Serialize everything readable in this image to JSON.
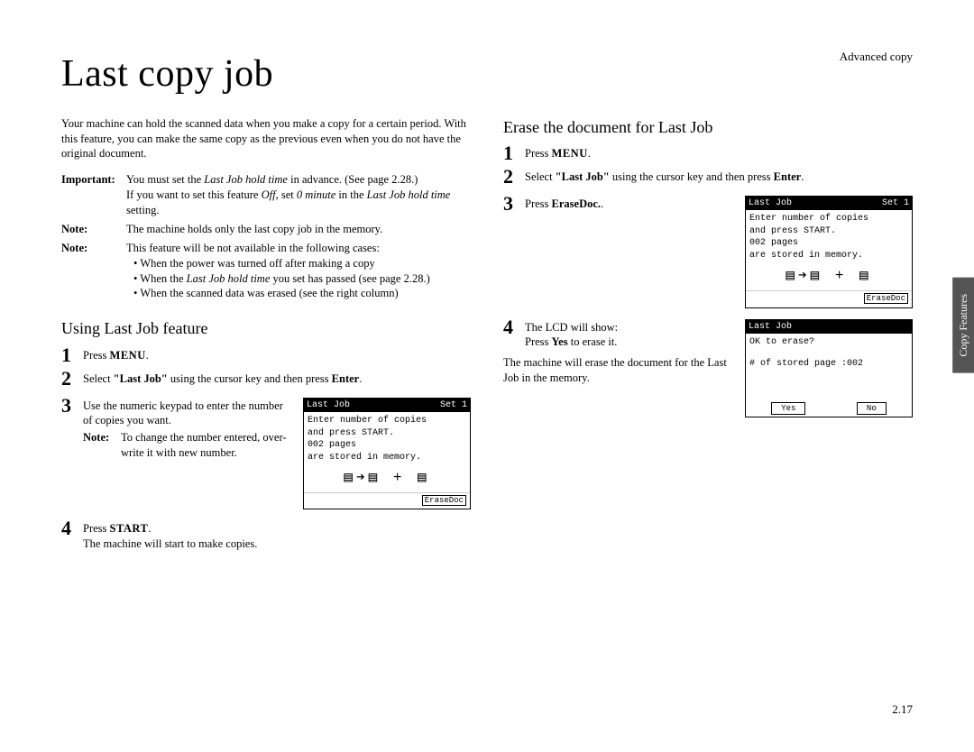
{
  "header": "Advanced copy",
  "title": "Last copy job",
  "intro": "Your machine can hold the scanned data when you make a copy for a certain period. With this feature, you can make the same copy as the previous even when you do not have the original document.",
  "important": {
    "label": "Important:",
    "line1a": "You must set the ",
    "line1b": "Last Job hold time",
    "line1c": " in advance. (See page 2.28.)",
    "line2a": "If you want to set this feature ",
    "line2b": "Off",
    "line2c": ", set ",
    "line2d": "0 minute",
    "line2e": " in the ",
    "line2f": "Last Job hold time",
    "line2g": " setting."
  },
  "note1": {
    "label": "Note:",
    "text": "The machine holds only the last copy job in the memory."
  },
  "note2": {
    "label": "Note:",
    "lead": "This feature will be not available in the following cases:",
    "b1": "When the power was turned off after making a copy",
    "b2a": "When the ",
    "b2b": "Last Job hold time",
    "b2c": " you set has passed (see page 2.28.)",
    "b3": "When the scanned data was erased (see the right column)"
  },
  "sec1": {
    "title": "Using Last Job feature",
    "s1a": "Press ",
    "s1b": "MENU",
    "s1c": ".",
    "s2a": "Select ",
    "s2b": "\"Last Job\"",
    "s2c": " using the cursor key and then press ",
    "s2d": "Enter",
    "s2e": ".",
    "s3": "Use the numeric keypad to enter the number of copies you want.",
    "s3nlabel": "Note:",
    "s3note": "To change the number entered, over-write it with new number.",
    "s4a": "Press ",
    "s4b": "START",
    "s4c": ".",
    "s4d": "The machine will start to make copies."
  },
  "lcd1": {
    "title": "Last Job",
    "set": "Set   1",
    "l1": "Enter number of copies",
    "l2": "and press START.",
    "l3": "002 pages",
    "l4": "are stored in memory.",
    "foot": "EraseDoc"
  },
  "sec2": {
    "title": "Erase the document for Last Job",
    "s1a": "Press ",
    "s1b": "MENU",
    "s1c": ".",
    "s2a": "Select ",
    "s2b": "\"Last Job\"",
    "s2c": " using the cursor key and then press ",
    "s2d": "Enter",
    "s2e": ".",
    "s3a": "Press ",
    "s3b": "EraseDoc.",
    "s3c": ".",
    "s4a": "The ",
    "s4b": "LCD",
    "s4c": " will show:",
    "s4d": "Press ",
    "s4e": "Yes",
    "s4f": " to erase it.",
    "tail": "The machine will erase the document for the Last Job in the memory."
  },
  "lcd2": {
    "title": "Last Job",
    "set": "Set   1",
    "l1": "Enter number of copies",
    "l2": "and press START.",
    "l3": "002 pages",
    "l4": "are stored in memory.",
    "foot": "EraseDoc"
  },
  "lcd3": {
    "title": "Last Job",
    "l1": "OK to erase?",
    "l2": "# of stored page :002",
    "yes": "Yes",
    "no": "No"
  },
  "sidetab": "Copy Features",
  "pagenum": "2.17",
  "icons": "▤➔▤ + ▤"
}
